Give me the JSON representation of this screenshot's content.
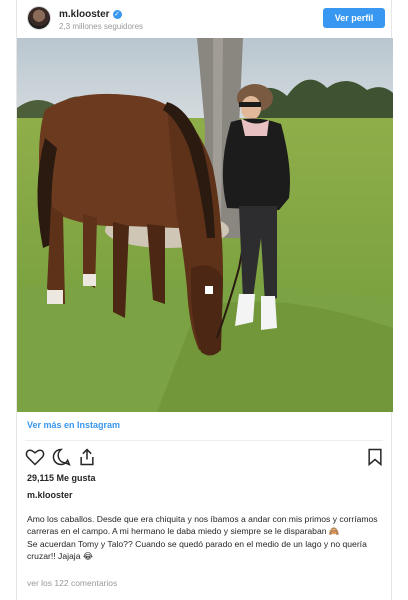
{
  "header": {
    "username": "m.klooster",
    "followers": "2,3 millones seguidores",
    "view_profile": "Ver perfil"
  },
  "more_link": "Ver más en Instagram",
  "likes": "29,115 Me gusta",
  "caption": {
    "username": "m.klooster",
    "paragraph_1": "Amo los caballos. Desde que era chiquita y nos íbamos a andar con mis primos y corríamos carreras en el campo. A mi hermano le daba miedo y siempre se le disparaban 🙈",
    "paragraph_2": "Se acuerdan Tomy y Talo?? Cuando se quedó parado en el medio de un lago y no quería cruzar!! Jajaja 😂"
  },
  "comments_link": "ver los 122 comentarios",
  "colors": {
    "accent": "#3897f0",
    "text": "#262626",
    "muted": "#999999"
  },
  "icons": [
    "heart-icon",
    "comment-icon",
    "share-icon",
    "bookmark-icon",
    "verified-icon"
  ]
}
